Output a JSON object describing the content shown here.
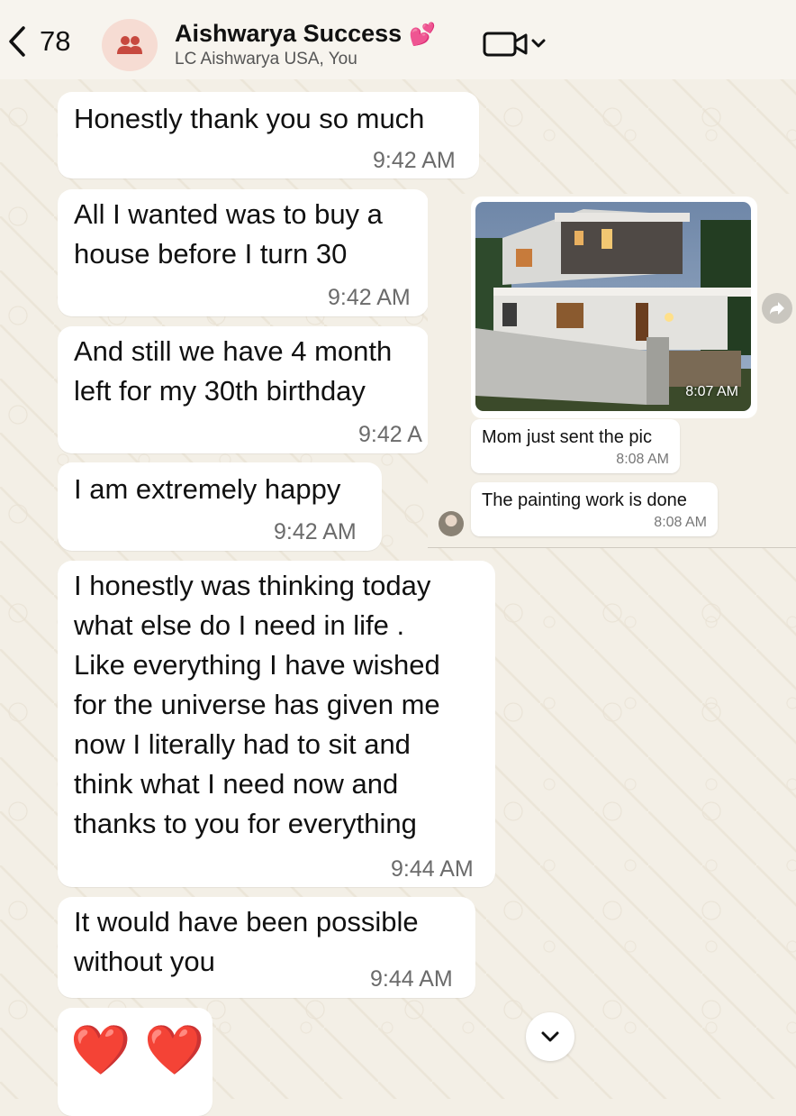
{
  "header": {
    "unread_count": "78",
    "title": "Aishwarya Success",
    "title_emoji": "💕",
    "subtitle": "LC Aishwarya USA, You",
    "back_icon": "chevron-left-icon",
    "group_icon": "group-people-icon",
    "video_icon": "video-call-icon"
  },
  "messages": [
    {
      "text": "Honestly thank you so much",
      "time": "9:42 AM"
    },
    {
      "text": "All I wanted was to buy a\nhouse before I turn 30",
      "time": "9:42 AM"
    },
    {
      "text": "And still we have 4 month\nleft for my 30th birthday",
      "time": "9:42 A"
    },
    {
      "text": "I am extremely happy",
      "time": "9:42 AM"
    },
    {
      "text": "I honestly was thinking today\nwhat else do I need in life .\nLike everything I have wished\nfor the universe has given me\nnow I literally had to sit and\nthink what I need now and\nthanks to you for everything",
      "time": "9:44 AM"
    },
    {
      "text": "It would have been possible\nwithout you",
      "time": "9:44 AM"
    },
    {
      "text": "❤️ ❤️"
    }
  ],
  "embedded_chat": {
    "photo_time": "8:07 AM",
    "replies": [
      {
        "text": "Mom just sent the pic",
        "time": "8:08 AM"
      },
      {
        "text": "The painting work is done",
        "time": "8:08 AM"
      }
    ]
  },
  "colors": {
    "background": "#f3efe6",
    "bubble": "#ffffff",
    "avatar_bg": "#f6dcd3",
    "heart": "#e53935"
  }
}
